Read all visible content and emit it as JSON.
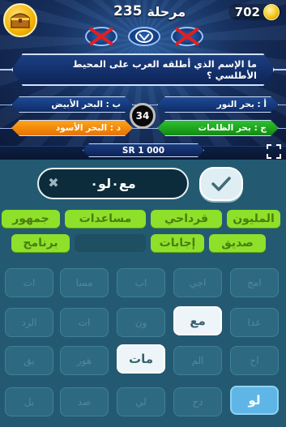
{
  "header": {
    "level_label": "مرحلة",
    "level_number": "235",
    "coins": "702"
  },
  "question": {
    "text": "ما الإسم الذي أطلقه العرب على المحيط الأطلسي ؟",
    "answers": [
      {
        "text": "أ : بحر النور"
      },
      {
        "text": "ب : البحر الأبيض"
      },
      {
        "text": "ج : بحر الظلمات"
      },
      {
        "text": "د : البحر الأسود"
      }
    ],
    "timer": "34",
    "prize": "SR 1 000"
  },
  "answer_input": {
    "value": "مع٠لو٠"
  },
  "hints": {
    "row1": [
      "المليون",
      "قرداحي",
      "مساعدات",
      "جمهور"
    ],
    "row2": [
      "صديق",
      "إجابات",
      "",
      "برنامج"
    ]
  },
  "tiles": [
    [
      "امج",
      "اجي",
      "اب",
      "مسا",
      "ات"
    ],
    [
      "عدا",
      "مع",
      "ون",
      "ات",
      "الرد"
    ],
    [
      "اح",
      "الم",
      "مات",
      "هور",
      "يق"
    ],
    [
      "لو",
      "دح",
      "لي",
      "صد",
      "بل"
    ]
  ],
  "colors": {
    "hint_green": "#8ee02a",
    "correct_answer": "#1ea51e",
    "selected_answer": "#ff8c00",
    "tile": "#2d6a81"
  }
}
